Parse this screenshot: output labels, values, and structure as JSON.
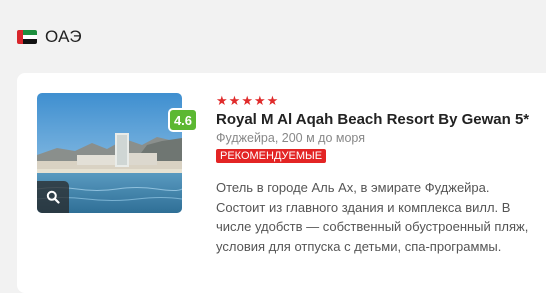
{
  "country": {
    "name": "ОАЭ",
    "flag_icon": "uae-flag-icon"
  },
  "hotel": {
    "stars": [
      "★",
      "★",
      "★",
      "★",
      "★"
    ],
    "rating": "4.6",
    "name": "Royal M Al Aqah Beach Resort By Gewan 5*",
    "location": "Фуджейра, 200 м до моря",
    "badge": "РЕКОМЕНДУЕМЫЕ",
    "description": "Отель в городе Аль Ах, в эмирате Фуджейра. Состоит из главного здания и комплекса вилл. В числе удобств — собственный обустроенный пляж, условия для отпуска с детьми, спа-программы.",
    "photo_icon": "search-icon"
  },
  "colors": {
    "accent_red": "#e02b2b",
    "rating_green": "#5cb832",
    "background": "#f2f2f2"
  }
}
